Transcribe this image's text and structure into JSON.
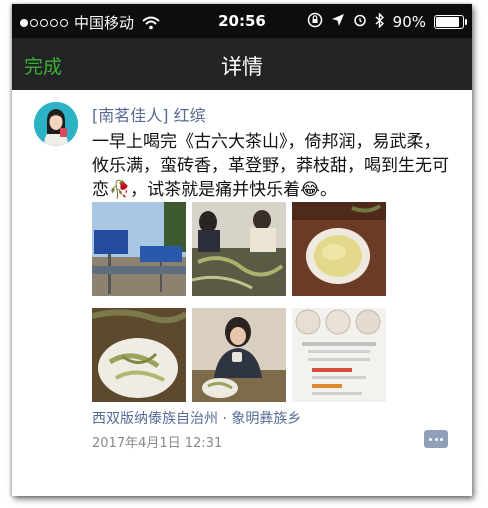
{
  "status_bar": {
    "carrier": "中国移动",
    "time": "20:56",
    "battery": "90%",
    "battery_level": 0.9,
    "signal_dots_filled": 1,
    "signal_dots_total": 5
  },
  "nav": {
    "done_label": "完成",
    "title": "详情",
    "done_color": "#3cb035"
  },
  "post": {
    "author": "[南茗佳人] 红缤",
    "text": "一早上喝完《古六大茶山》，倚邦润，易武柔，攸乐满，蛮砖香，革登野，莽枝甜，喝到生无可恋🥀，试茶就是痛并快乐着😂。",
    "location": "西双版纳傣族自治州 · 象明彝族乡",
    "timestamp": "2017年4月1日 12:31",
    "link_color": "#576b95"
  },
  "images": [
    {
      "name": "road-sign-photo"
    },
    {
      "name": "woman-tea-tasting-photo"
    },
    {
      "name": "tea-cup-photo"
    },
    {
      "name": "tea-leaves-bowl-photo"
    },
    {
      "name": "woman-drinking-tea-photo"
    },
    {
      "name": "tea-cakes-product-photo"
    }
  ]
}
